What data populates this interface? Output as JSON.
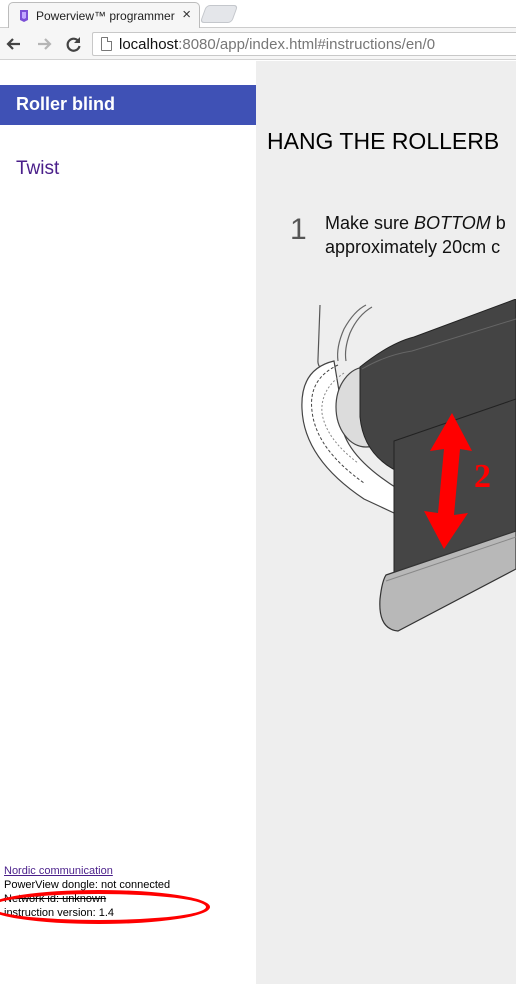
{
  "browser": {
    "tab_title": "Powerview™ programmer",
    "tab_close": "×",
    "url_host": "localhost",
    "url_rest": ":8080/app/index.html#instructions/en/0",
    "icons": [
      "back-arrow-icon",
      "forward-arrow-icon",
      "reload-icon",
      "page-icon"
    ]
  },
  "sidebar": {
    "title": "Roller blind",
    "items": [
      {
        "label": "Twist"
      }
    ],
    "accent_color": "#3f51b5"
  },
  "footer": {
    "link": "Nordic communication",
    "dongle_status": "PowerView dongle: not connected",
    "network_status": "Network id: unknown",
    "instruction_version": "instruction version: 1.4"
  },
  "instructions": {
    "title": "HANG THE ROLLERB",
    "steps": [
      {
        "number": "1",
        "text_before": "Make sure ",
        "text_emphasis": "BOTTOM",
        "text_after": " b",
        "text_line2": "approximately 20cm c"
      }
    ],
    "illustration_label": "2"
  }
}
